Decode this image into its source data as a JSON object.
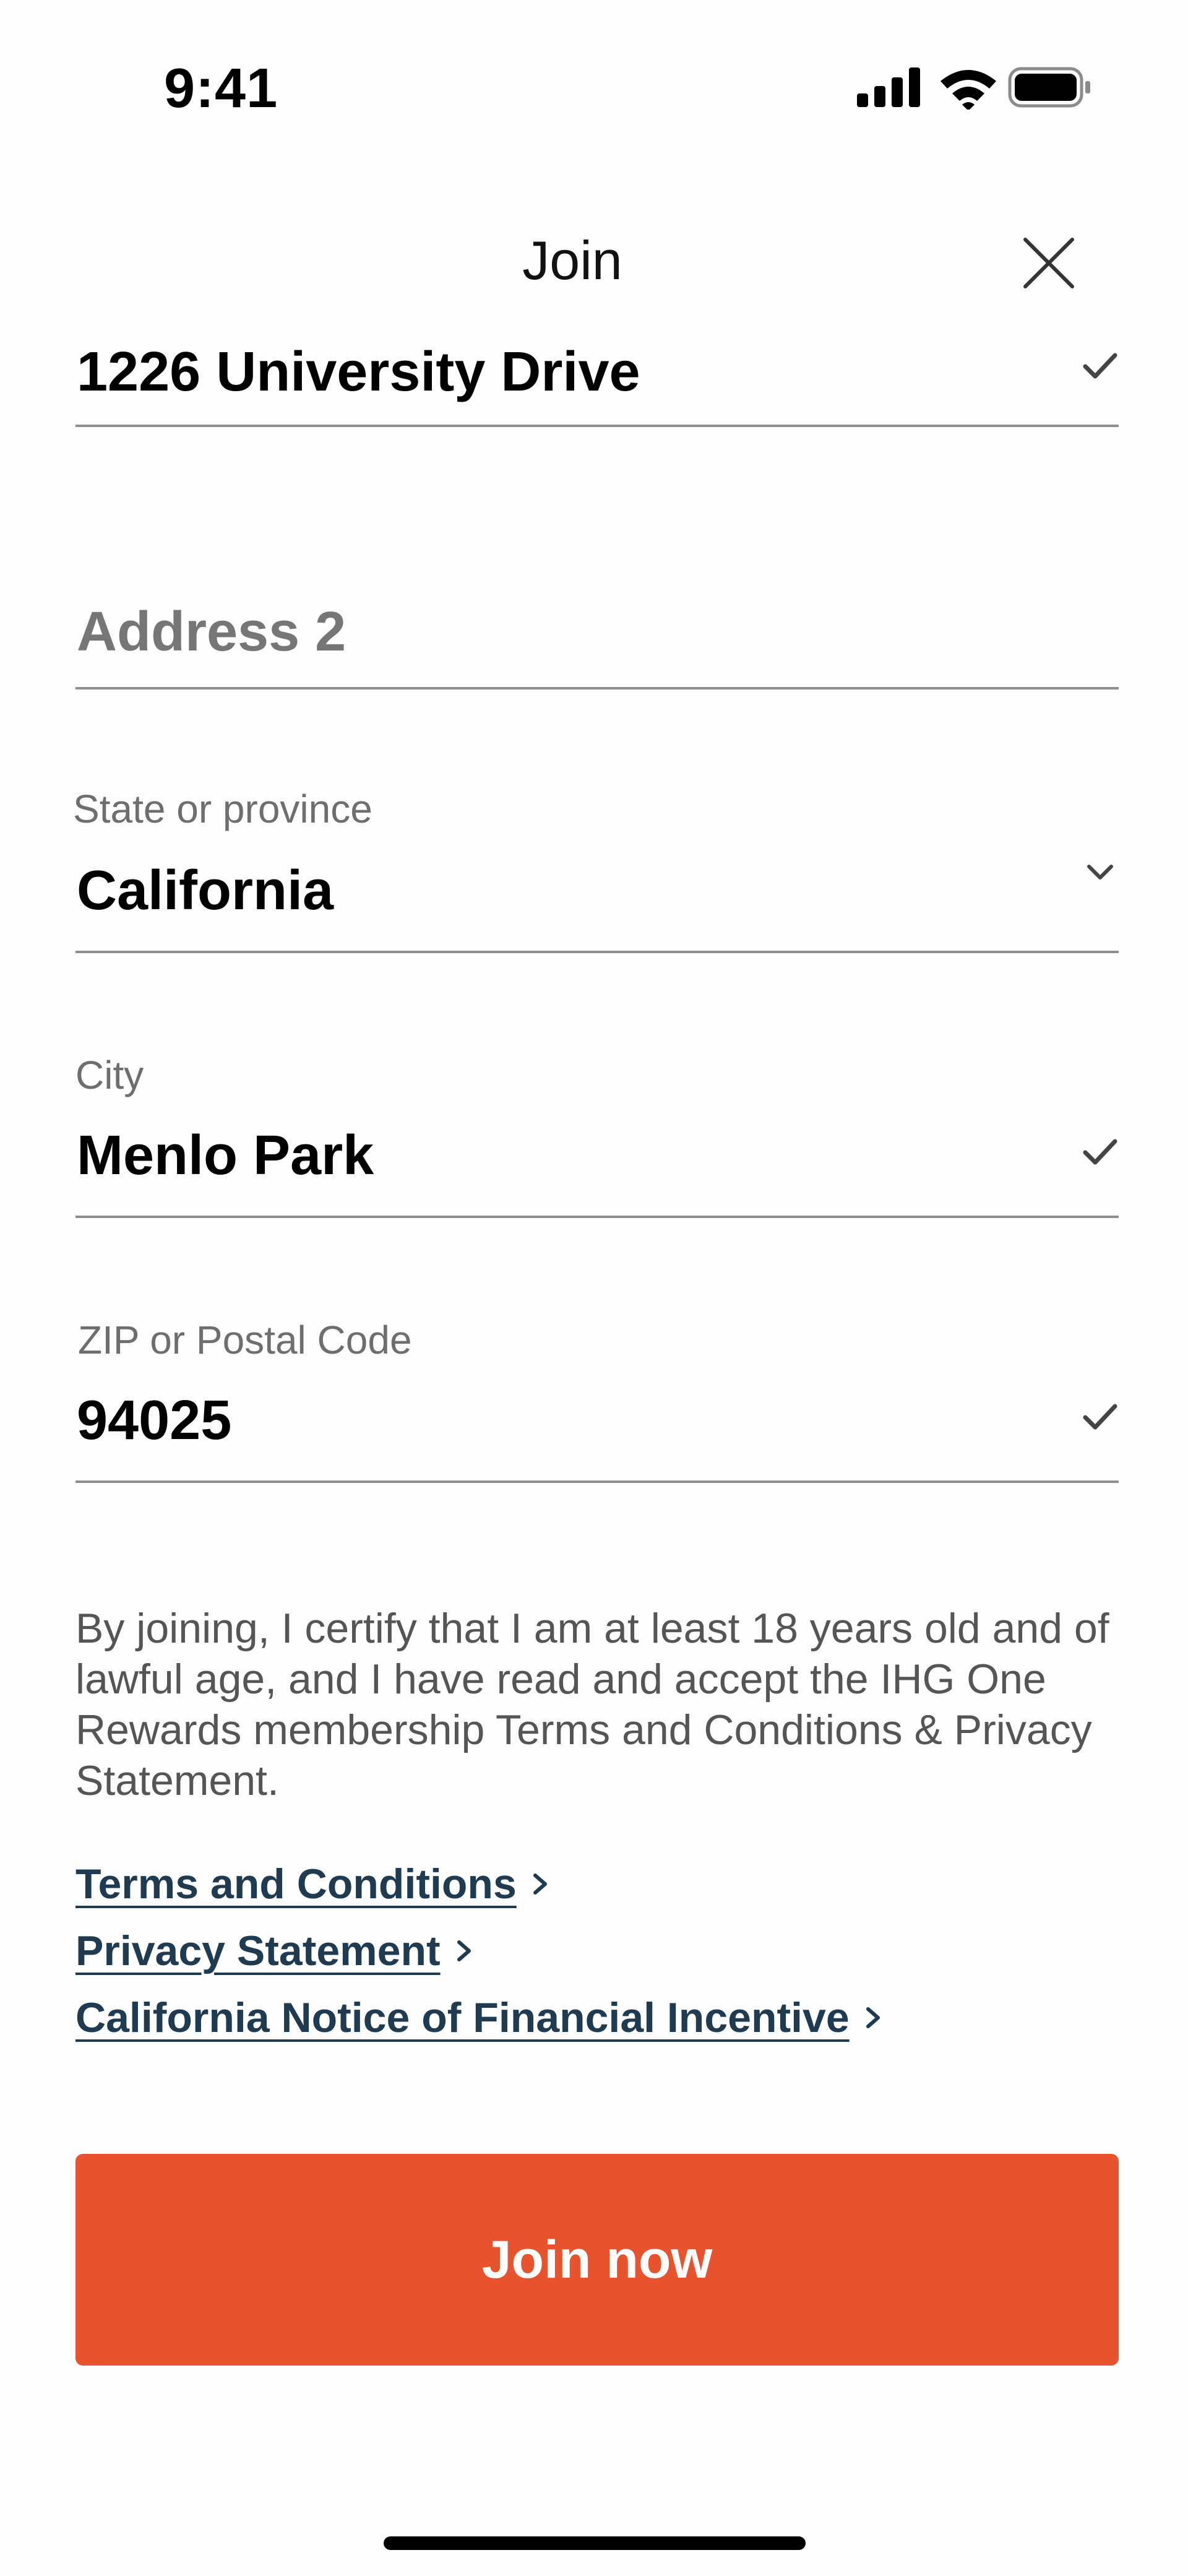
{
  "status_bar": {
    "time": "9:41"
  },
  "header": {
    "title": "Join",
    "close_icon": "close-icon"
  },
  "form": {
    "address1": {
      "value": "1226 University Drive",
      "status_icon": "checkmark-icon"
    },
    "address2": {
      "placeholder": "Address 2",
      "value": ""
    },
    "state": {
      "label": "State or province",
      "value": "California",
      "status_icon": "chevron-down-icon"
    },
    "city": {
      "label": "City",
      "value": "Menlo Park",
      "status_icon": "checkmark-icon"
    },
    "zip": {
      "label": "ZIP or Postal Code",
      "value": "94025",
      "status_icon": "checkmark-icon"
    }
  },
  "legal": {
    "text": "By joining, I certify that I am at least 18 years old and of lawful age, and I have read and accept the IHG One Rewards membership Terms and Conditions & Privacy Statement.",
    "links": [
      {
        "label": "Terms and Conditions"
      },
      {
        "label": "Privacy Statement"
      },
      {
        "label": "California Notice of Financial Incentive"
      }
    ]
  },
  "actions": {
    "join_label": "Join now"
  },
  "colors": {
    "accent": "#e8522d",
    "link": "#1f3b52",
    "divider": "#8f8f8f",
    "label": "#6e6e6e"
  }
}
